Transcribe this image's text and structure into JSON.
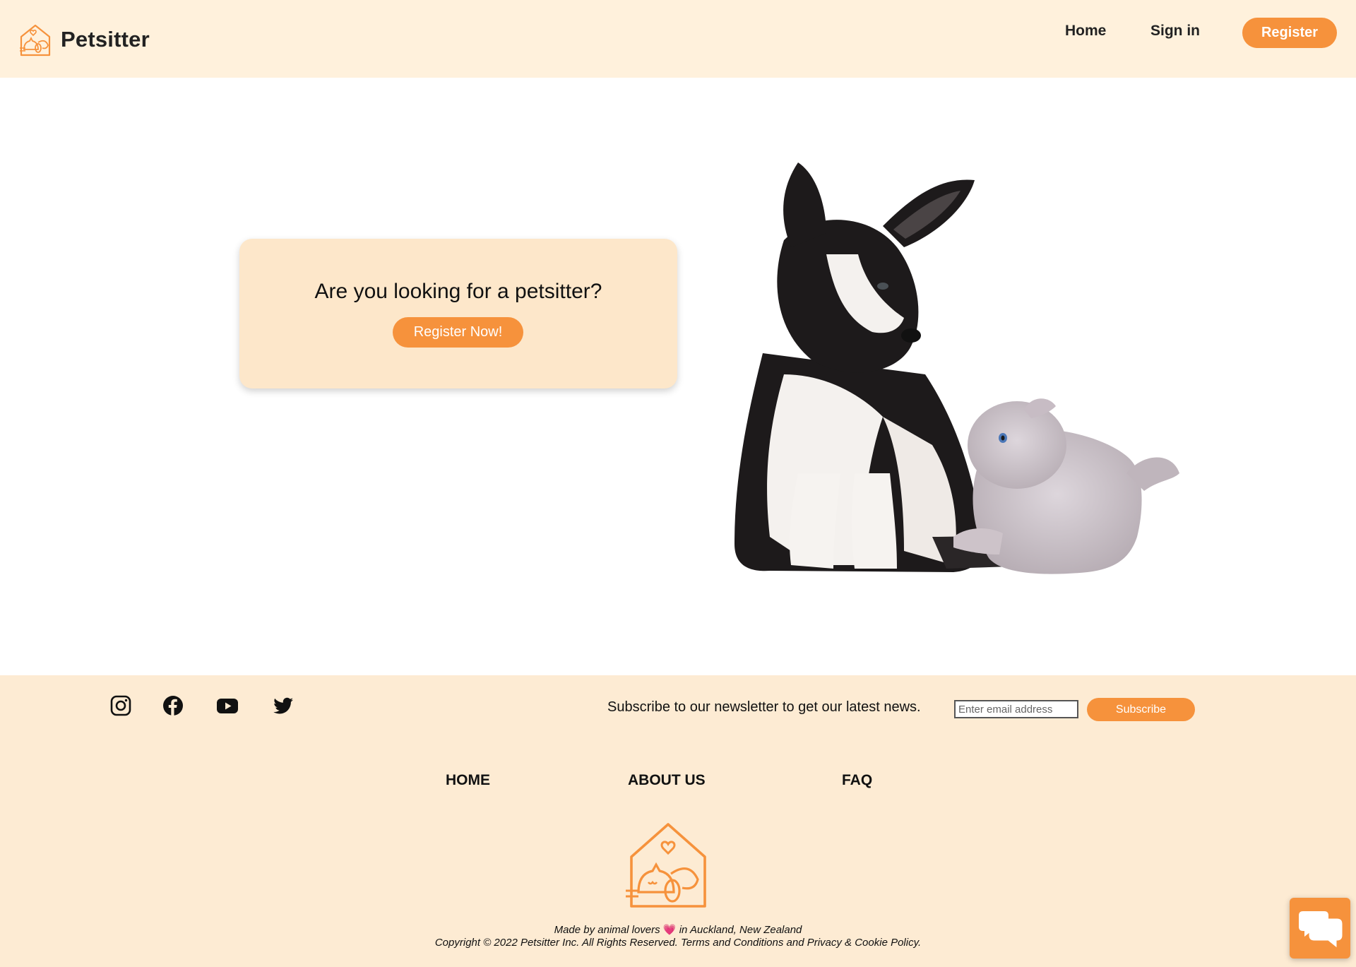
{
  "header": {
    "brand_name": "Petsitter",
    "nav": {
      "home": "Home",
      "sign_in": "Sign in",
      "register": "Register"
    }
  },
  "hero": {
    "title": "Are you looking for a petsitter?",
    "button_label": "Register Now!",
    "image_subject": "husky puppy and grey kitten"
  },
  "footer": {
    "social": [
      "instagram-icon",
      "facebook-icon",
      "youtube-icon",
      "twitter-icon"
    ],
    "newsletter": {
      "text": "Subscribe to our newsletter to get our latest news.",
      "email_placeholder": "Enter email address",
      "subscribe_label": "Subscribe"
    },
    "links": {
      "home": "HOME",
      "about": "ABOUT US",
      "faq": "FAQ"
    },
    "made_by_prefix": "Made by animal lovers",
    "made_by_heart": "💗",
    "made_by_suffix": "in Auckland, New Zealand",
    "copyright": "Copyright © 2022 Petsitter Inc. All Rights Reserved. Terms and Conditions and Privacy & Cookie Policy."
  },
  "colors": {
    "accent": "#f6923c",
    "header_bg": "#fff1dc",
    "footer_bg": "#fdebd3",
    "card_bg": "#fde7ca"
  }
}
